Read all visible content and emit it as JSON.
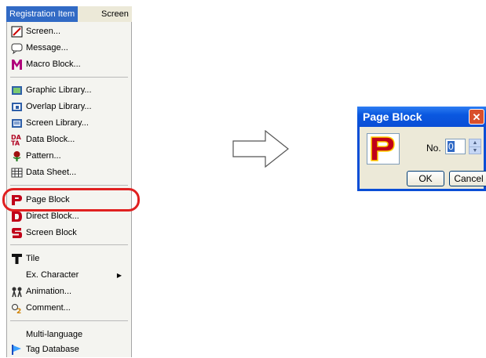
{
  "menubar": {
    "active": "Registration Item",
    "next": "Screen"
  },
  "menu": {
    "items": [
      {
        "label": "Screen...",
        "icon": "screen-icon"
      },
      {
        "label": "Message...",
        "icon": "message-icon"
      },
      {
        "label": "Macro Block...",
        "icon": "macro-block-icon"
      },
      {
        "label": "Graphic Library...",
        "icon": "graphic-library-icon"
      },
      {
        "label": "Overlap Library...",
        "icon": "overlap-library-icon"
      },
      {
        "label": "Screen Library...",
        "icon": "screen-library-icon"
      },
      {
        "label": "Data Block...",
        "icon": "data-block-icon"
      },
      {
        "label": "Pattern...",
        "icon": "pattern-icon"
      },
      {
        "label": "Data Sheet...",
        "icon": "data-sheet-icon"
      },
      {
        "label": "Page Block",
        "icon": "page-block-icon"
      },
      {
        "label": "Direct Block...",
        "icon": "direct-block-icon"
      },
      {
        "label": "Screen Block",
        "icon": "screen-block-icon"
      },
      {
        "label": "Tile",
        "icon": "tile-icon"
      },
      {
        "label": "Ex. Character",
        "icon": "",
        "submenu": true
      },
      {
        "label": "Animation...",
        "icon": "animation-icon"
      },
      {
        "label": "Comment...",
        "icon": "comment-icon"
      },
      {
        "label": "Multi-language",
        "icon": ""
      },
      {
        "label": "Tag Database",
        "icon": "tag-database-icon"
      }
    ]
  },
  "dialog": {
    "title": "Page Block",
    "close_icon": "close-icon",
    "no_label": "No.",
    "no_value": "0",
    "ok_label": "OK",
    "cancel_label": "Cancel"
  },
  "colors": {
    "highlight": "#e02020",
    "menu_active": "#316ac5",
    "titlebar": "#0a4ed6"
  }
}
